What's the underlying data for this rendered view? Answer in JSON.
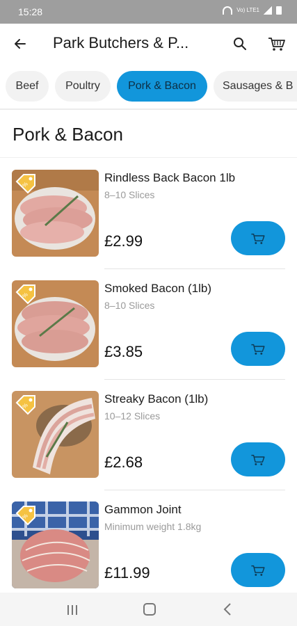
{
  "status": {
    "time": "15:28",
    "network_label": "Vo) LTE1"
  },
  "appbar": {
    "title": "Park Butchers & P..."
  },
  "tabs": [
    {
      "label": "Beef"
    },
    {
      "label": "Poultry"
    },
    {
      "label": "Pork & Bacon",
      "active": true
    },
    {
      "label": "Sausages & B"
    }
  ],
  "section": {
    "title": "Pork & Bacon"
  },
  "products": [
    {
      "name": "Rindless Back Bacon 1lb",
      "desc": "8–10 Slices",
      "price": "£2.99",
      "tag_icon": "discount-tag-icon"
    },
    {
      "name": "Smoked Bacon (1lb)",
      "desc": "8–10 Slices",
      "price": "£3.85",
      "tag_icon": "discount-tag-icon"
    },
    {
      "name": "Streaky Bacon (1lb)",
      "desc": "10–12 Slices",
      "price": "£2.68",
      "tag_icon": "discount-tag-icon"
    },
    {
      "name": "Gammon Joint",
      "desc": "Minimum weight 1.8kg",
      "price": "£11.99",
      "tag_icon": "discount-tag-icon"
    }
  ],
  "colors": {
    "accent": "#1296db",
    "status_bar": "#9e9e9e",
    "tag": "#f5c242"
  }
}
